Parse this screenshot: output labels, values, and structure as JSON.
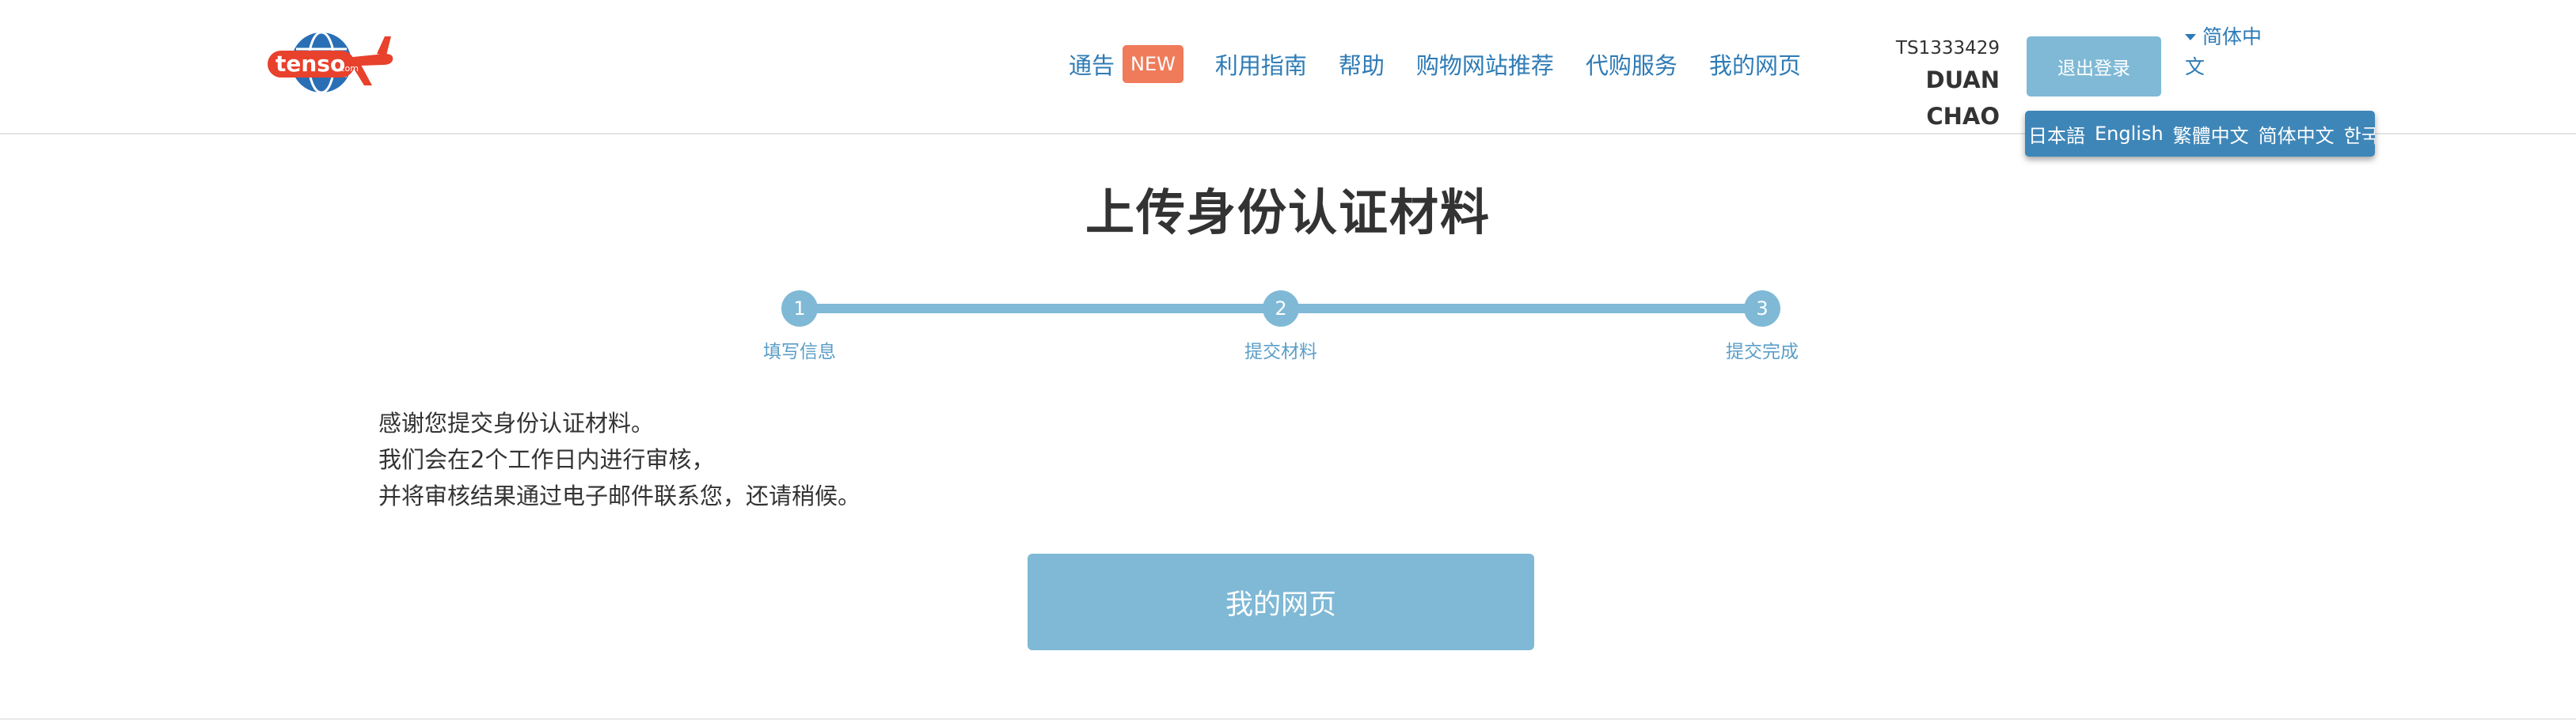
{
  "header": {
    "logo_text": "tenso",
    "logo_suffix": ".com",
    "nav": [
      {
        "label": "通告",
        "badge": "NEW"
      },
      {
        "label": "利用指南"
      },
      {
        "label": "帮助"
      },
      {
        "label": "购物网站推荐"
      },
      {
        "label": "代购服务"
      },
      {
        "label": "我的网页"
      }
    ],
    "user": {
      "id": "TS1333429",
      "name": "DUAN CHAO"
    },
    "logout_label": "退出登录",
    "language": {
      "current": "简体中文",
      "options": [
        "日本語",
        "English",
        "繁體中文",
        "简体中文",
        "한국어"
      ]
    }
  },
  "main": {
    "title": "上传身份认证材料",
    "steps": [
      {
        "number": "1",
        "label": "填写信息"
      },
      {
        "number": "2",
        "label": "提交材料"
      },
      {
        "number": "3",
        "label": "提交完成"
      }
    ],
    "message_lines": [
      "感谢您提交身份认证材料。",
      "我们会在2个工作日内进行审核，",
      "并将审核结果通过电子邮件联系您，还请稍候。"
    ],
    "mypage_button": "我的网页"
  },
  "colors": {
    "link": "#2e7bb6",
    "accent": "#7fb9d6",
    "badge": "#f07b5a",
    "logo_red": "#e8412c",
    "logo_blue": "#2a6fb5"
  }
}
